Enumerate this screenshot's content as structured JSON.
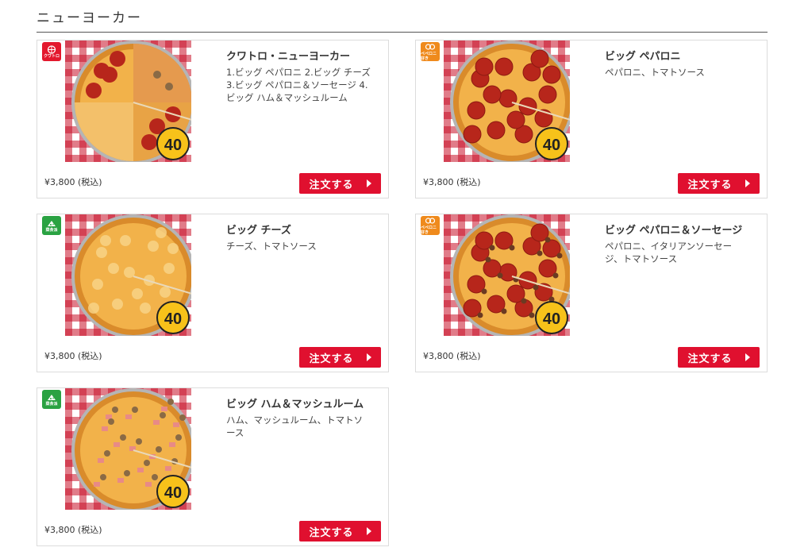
{
  "section": {
    "title": "ニューヨーカー"
  },
  "order_label": "注文する",
  "badges": {
    "quattro": {
      "text": "クワトロ",
      "icon": "quattro-pizza-icon",
      "color": "#e3182d"
    },
    "pepperoni_lover": {
      "text": "ペペロニ好き",
      "icon": "pepperoni-icon",
      "color": "#ef8a1c"
    },
    "veggie": {
      "text": "菜食派",
      "icon": "cheese-icon",
      "color": "#2aa242"
    }
  },
  "products": [
    {
      "name": "クワトロ・ニューヨーカー",
      "desc_lines": [
        "1.ビッグ ペパロニ 2.ビッグ チーズ",
        "3.ビッグ ペパロニ＆ソーセージ 4.",
        "ビッグ ハム＆マッシュルーム"
      ],
      "price": "¥3,800 (税込)",
      "badge": "quattro",
      "topping": "quattro",
      "size_badge": "40"
    },
    {
      "name": "ビッグ ペパロニ",
      "desc_lines": [
        "ペパロニ、トマトソース"
      ],
      "price": "¥3,800 (税込)",
      "badge": "pepperoni_lover",
      "topping": "pepperoni",
      "size_badge": "40"
    },
    {
      "name": "ビッグ チーズ",
      "desc_lines": [
        "チーズ、トマトソース"
      ],
      "price": "¥3,800 (税込)",
      "badge": "veggie",
      "topping": "cheese",
      "size_badge": "40"
    },
    {
      "name": "ビッグ ペパロニ＆ソーセージ",
      "desc_lines": [
        "ペパロニ、イタリアンソーセー",
        "ジ、トマトソース"
      ],
      "price": "¥3,800 (税込)",
      "badge": "pepperoni_lover",
      "topping": "sausage",
      "size_badge": "40"
    },
    {
      "name": "ビッグ ハム＆マッシュルーム",
      "desc_lines": [
        "ハム、マッシュルーム、トマトソ",
        "ース"
      ],
      "price": "¥3,800 (税込)",
      "badge": "veggie",
      "topping": "ham",
      "size_badge": "40"
    }
  ],
  "colors": {
    "accent": "#e0102f",
    "border": "#dcdcdc"
  }
}
